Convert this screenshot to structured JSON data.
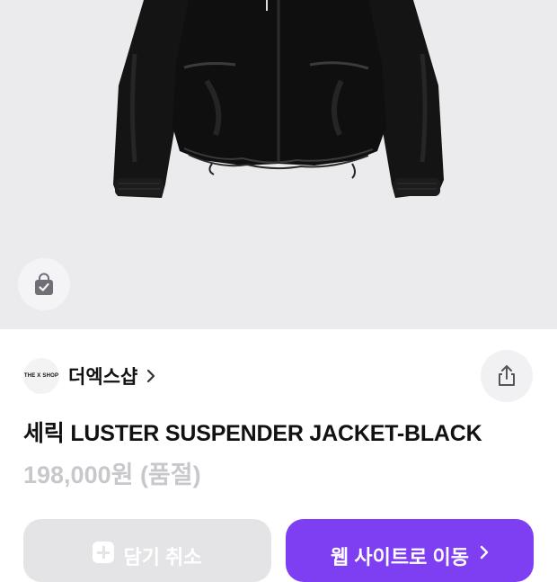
{
  "product_image": {
    "icon": "jacket-photo",
    "background": "#ebebed"
  },
  "bag_button": {
    "icon": "shopping-bag-check-icon"
  },
  "store": {
    "logo_text": "THE X SHOP",
    "name": "더엑스샵",
    "chevron_icon": "chevron-right-icon"
  },
  "share_button": {
    "icon": "share-icon"
  },
  "product": {
    "title": "세릭 LUSTER SUSPENDER JACKET-BLACK",
    "price_status": "198,000원 (품절)"
  },
  "actions": {
    "cancel_label": "담기 취소",
    "web_label": "웹 사이트로 이동",
    "accent_color": "#7e3ff2",
    "disabled_color": "#e4e4e7"
  }
}
